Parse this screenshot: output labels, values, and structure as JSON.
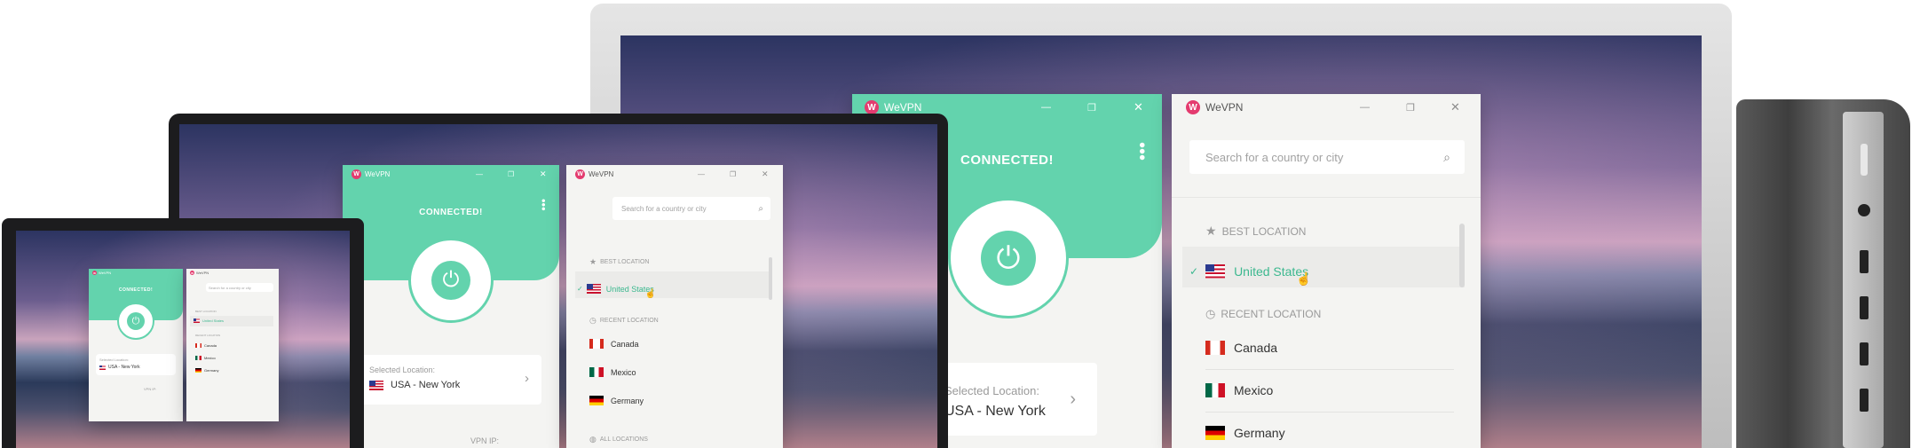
{
  "app": {
    "name": "WeVPN",
    "logo_letter": "W"
  },
  "status": {
    "connected_label": "CONNECTED!"
  },
  "selected_location": {
    "caption": "Selected Location:",
    "value": "USA - New York"
  },
  "vpn_ip_label": "VPN IP:",
  "search": {
    "placeholder": "Search for a country or city"
  },
  "sections": {
    "best": "BEST LOCATION",
    "recent": "RECENT LOCATION",
    "all": "ALL LOCATIONS"
  },
  "locations": {
    "best": "United States",
    "recent": [
      "Canada",
      "Mexico",
      "Germany"
    ]
  },
  "icons": {
    "power": "power-icon",
    "menu": "kebab-menu-icon",
    "search": "search-icon",
    "star": "star-icon",
    "clock": "clock-icon",
    "check": "check-icon",
    "chevron": "chevron-right-icon"
  },
  "colors": {
    "accent": "#63d3ad",
    "brand": "#e43b6f",
    "selected_text": "#3cb88f"
  }
}
